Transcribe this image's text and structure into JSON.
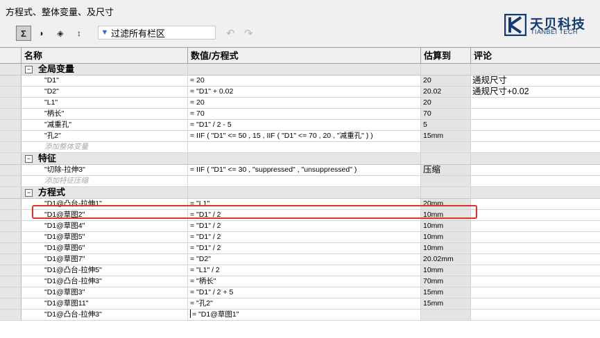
{
  "window": {
    "title": "方程式、整体变量、及尺寸"
  },
  "toolbar": {
    "filter_placeholder": "过滤所有栏区",
    "buttons": [
      "Σ",
      "◑",
      "◈",
      "↕"
    ]
  },
  "logo": {
    "cn": "天贝科技",
    "en": "TIANBEI TECH",
    "color": "#143a73"
  },
  "columns": [
    "名称",
    "数值/方程式",
    "估算到",
    "评论"
  ],
  "sections": {
    "global": {
      "label": "全局变量",
      "add_label": "添加整体变量"
    },
    "features": {
      "label": "特征",
      "add_label": "添加特征压缩"
    },
    "equations": {
      "label": "方程式"
    }
  },
  "global_rows": [
    {
      "name": "\"D1\"",
      "value": "= 20",
      "eval": "20",
      "comment": "通规尺寸"
    },
    {
      "name": "\"D2\"",
      "value": "= \"D1\" + 0.02",
      "eval": "20.02",
      "comment": "通规尺寸+0.02"
    },
    {
      "name": "\"L1\"",
      "value": "= 20",
      "eval": "20",
      "comment": ""
    },
    {
      "name": "\"柄长\"",
      "value": "= 70",
      "eval": "70",
      "comment": ""
    },
    {
      "name": "\"减重孔\"",
      "value": "= \"D1\" / 2 - 5",
      "eval": "5",
      "comment": ""
    },
    {
      "name": "\"孔2\"",
      "value": "= IIF ( \"D1\" <= 50 , 15 , IIF ( \"D1\" <= 70 , 20 , \"减重孔\" ) )",
      "eval": "15mm",
      "comment": ""
    }
  ],
  "feature_rows": [
    {
      "name": "\"切除-拉伸3\"",
      "value": "= IIF ( \"D1\" <= 30 , \"suppressed\" , \"unsuppressed\" )",
      "eval": "压缩",
      "comment": ""
    }
  ],
  "equation_rows": [
    {
      "name": "\"D1@凸台-拉伸1\"",
      "value": "= \"L1\"",
      "eval": "20mm",
      "comment": ""
    },
    {
      "name": "\"D1@草图2\"",
      "value": "= \"D1\" / 2",
      "eval": "10mm",
      "comment": ""
    },
    {
      "name": "\"D1@草图4\"",
      "value": "= \"D1\" / 2",
      "eval": "10mm",
      "comment": ""
    },
    {
      "name": "\"D1@草图5\"",
      "value": "= \"D1\" / 2",
      "eval": "10mm",
      "comment": ""
    },
    {
      "name": "\"D1@草图6\"",
      "value": "= \"D1\" / 2",
      "eval": "10mm",
      "comment": ""
    },
    {
      "name": "\"D1@草图7\"",
      "value": "= \"D2\"",
      "eval": "20.02mm",
      "comment": ""
    },
    {
      "name": "\"D1@凸台-拉伸5\"",
      "value": "= \"L1\" / 2",
      "eval": "10mm",
      "comment": ""
    },
    {
      "name": "\"D1@凸台-拉伸3\"",
      "value": "= \"柄长\"",
      "eval": "70mm",
      "comment": ""
    },
    {
      "name": "\"D1@草图3\"",
      "value": "= \"D1\" / 2 + 5",
      "eval": "15mm",
      "comment": ""
    },
    {
      "name": "\"D1@草图11\"",
      "value": "= \"孔2\"",
      "eval": "15mm",
      "comment": ""
    },
    {
      "name": "\"D1@凸台-拉伸3\"",
      "value": "= \"D1@草图1\"",
      "eval": "",
      "comment": ""
    }
  ]
}
